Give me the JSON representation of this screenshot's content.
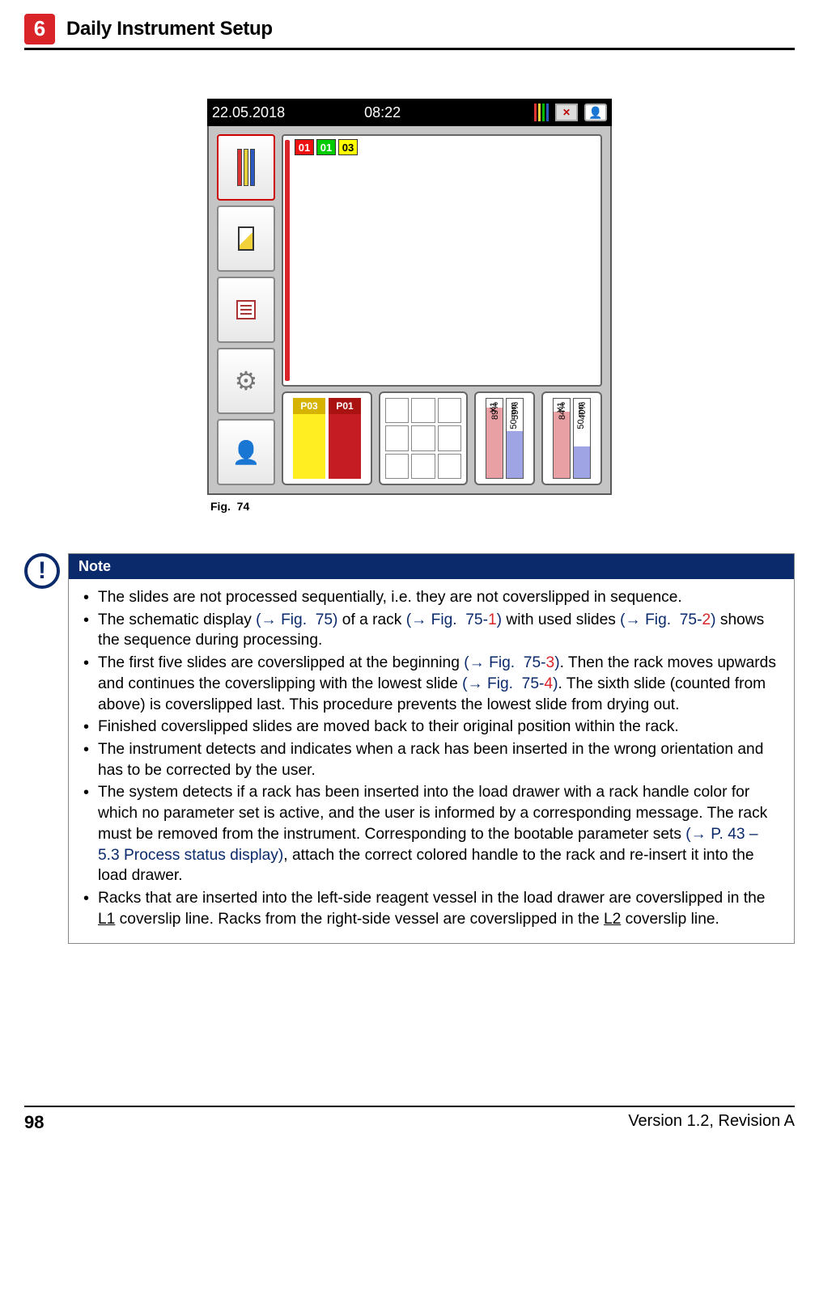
{
  "header": {
    "chapter_number": "6",
    "chapter_title": "Daily Instrument Setup"
  },
  "statusbar": {
    "date": "22.05.2018",
    "time": "08:22"
  },
  "canvas": {
    "chips": [
      "01",
      "01",
      "03"
    ]
  },
  "trays": {
    "columns": [
      {
        "label": "P03"
      },
      {
        "label": "P01"
      }
    ],
    "levels_a": [
      {
        "label": "X1",
        "pct": "89%",
        "fill": 89,
        "color": "#e9a0a5"
      },
      {
        "label": "50 mm",
        "pct": "59%",
        "fill": 59,
        "color": "#9ea4e4"
      }
    ],
    "levels_b": [
      {
        "label": "X1",
        "pct": "84%",
        "fill": 84,
        "color": "#e9a0a5"
      },
      {
        "label": "50 mm",
        "pct": "40%",
        "fill": 40,
        "color": "#9ea4e4"
      }
    ]
  },
  "figure_caption": "Fig.  74",
  "note": {
    "title": "Note",
    "items": [
      [
        {
          "t": "The slides are not processed sequentially, i.e. they are not coverslipped in sequence."
        }
      ],
      [
        {
          "t": "The schematic display "
        },
        {
          "t": "(→ Fig.  75)",
          "cls": "ref"
        },
        {
          "t": " of a rack "
        },
        {
          "t": "(→ Fig.  75-",
          "cls": "ref"
        },
        {
          "t": "1",
          "cls": "ref-red"
        },
        {
          "t": ")",
          "cls": "ref"
        },
        {
          "t": " with used slides "
        },
        {
          "t": "(→ Fig.  75-",
          "cls": "ref"
        },
        {
          "t": "2",
          "cls": "ref-red"
        },
        {
          "t": ")",
          "cls": "ref"
        },
        {
          "t": " shows the sequence during processing."
        }
      ],
      [
        {
          "t": "The first five slides are coverslipped at the beginning "
        },
        {
          "t": "(→ Fig.  75-",
          "cls": "ref"
        },
        {
          "t": "3",
          "cls": "ref-red"
        },
        {
          "t": ")",
          "cls": "ref"
        },
        {
          "t": ". Then the rack moves upwards and continues the coverslipping with the lowest slide "
        },
        {
          "t": "(→ Fig.  75-",
          "cls": "ref"
        },
        {
          "t": "4",
          "cls": "ref-red"
        },
        {
          "t": ")",
          "cls": "ref"
        },
        {
          "t": ". The sixth slide (counted from above) is coverslipped last. This procedure prevents the lowest slide from drying out."
        }
      ],
      [
        {
          "t": "Finished coverslipped slides are moved back to their original position within the rack."
        }
      ],
      [
        {
          "t": "The instrument detects and indicates when a rack has been inserted in the wrong orientation and has to be corrected by the user."
        }
      ],
      [
        {
          "t": "The system detects if a rack has been inserted into the load drawer with a rack handle color for which no parameter set is active, and the user is informed by a corresponding message. The rack must be removed from the instrument. Corresponding to the bootable parameter sets "
        },
        {
          "t": "(→ P. 43 – 5.3 Process status display)",
          "cls": "ref"
        },
        {
          "t": ", attach the correct colored handle to the rack and re-insert it into the load drawer."
        }
      ],
      [
        {
          "t": "Racks that are inserted into the left-side reagent vessel in the load drawer are coverslipped in the "
        },
        {
          "t": "L1",
          "cls": "underline"
        },
        {
          "t": " coverslip line. Racks from the right-side vessel are coverslipped in the "
        },
        {
          "t": "L2",
          "cls": "underline"
        },
        {
          "t": " coverslip line."
        }
      ]
    ]
  },
  "footer": {
    "page": "98",
    "version": "Version 1.2, Revision A"
  }
}
